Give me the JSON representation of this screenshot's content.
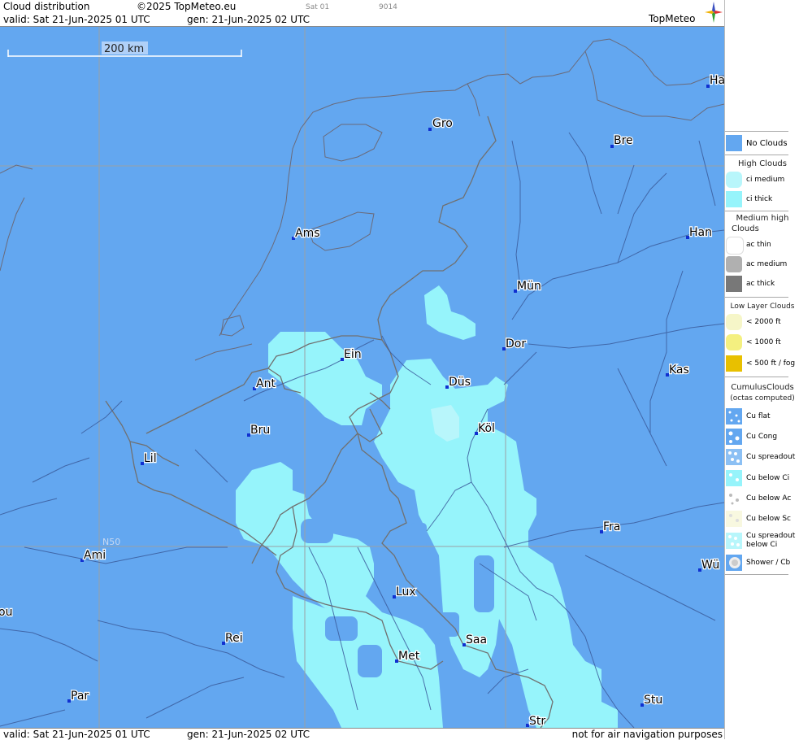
{
  "header": {
    "title": "Cloud distribution",
    "copyright": "©2025 TopMeteo.eu",
    "sat_tag": "Sat 01",
    "code": "9014",
    "valid": "valid:  Sat  21-Jun-2025  01 UTC",
    "gen": "gen: 21-Jun-2025 02 UTC",
    "logo_text": "TopMeteo"
  },
  "footer": {
    "valid": "valid:  Sat  21-Jun-2025  01 UTC",
    "gen": "gen: 21-Jun-2025 02 UTC",
    "disclaimer": "not for air navigation purposes"
  },
  "map": {
    "scale_label": "200 km",
    "lat_label": "N50",
    "cities": [
      {
        "label": "Gro"
      },
      {
        "label": "Bre"
      },
      {
        "label": "Ha"
      },
      {
        "label": "Ams"
      },
      {
        "label": "Han"
      },
      {
        "label": "Mün"
      },
      {
        "label": "Ein"
      },
      {
        "label": "Dor"
      },
      {
        "label": "Ant"
      },
      {
        "label": "Düs"
      },
      {
        "label": "Kas"
      },
      {
        "label": "Bru"
      },
      {
        "label": "Köl"
      },
      {
        "label": "Lil"
      },
      {
        "label": "Fra"
      },
      {
        "label": "Ami"
      },
      {
        "label": "Lux"
      },
      {
        "label": "Wü"
      },
      {
        "label": "ou"
      },
      {
        "label": "Rei"
      },
      {
        "label": "Saa"
      },
      {
        "label": "Met"
      },
      {
        "label": "Par"
      },
      {
        "label": "Stu"
      },
      {
        "label": "Str"
      }
    ]
  },
  "legend": {
    "no_clouds": "No Clouds",
    "high_head": "High Clouds",
    "ci_medium": "ci medium",
    "ci_thick": "ci thick",
    "medium_head_1": "Medium high",
    "medium_head_2": "Clouds",
    "ac_thin": "ac thin",
    "ac_medium": "ac medium",
    "ac_thick": "ac thick",
    "low_head": "Low Layer Clouds",
    "low_2000": "< 2000 ft",
    "low_1000": "< 1000 ft",
    "low_500": "< 500 ft / fog",
    "cumulus_head": "CumulusClouds",
    "cumulus_sub": "(octas computed)",
    "cu_flat": "Cu flat",
    "cu_cong": "Cu Cong",
    "cu_spreadout": "Cu spreadout",
    "cu_below_ci": "Cu below Ci",
    "cu_below_ac": "Cu below Ac",
    "cu_below_sc": "Cu below Sc",
    "cu_spreadout_below_ci_1": "Cu spreadout",
    "cu_spreadout_below_ci_2": "below Ci",
    "shower": "Shower / Cb"
  },
  "colors": {
    "no_clouds": "#63a7f0",
    "ci_thick": "#96f4fb",
    "ci_medium": "#b8f6fb",
    "ac_thin": "#ffffff",
    "ac_medium": "#b0b0b0",
    "ac_thick": "#787878",
    "low_2000": "#f6f6c8",
    "low_1000": "#f4f080",
    "low_500": "#e8c000"
  }
}
